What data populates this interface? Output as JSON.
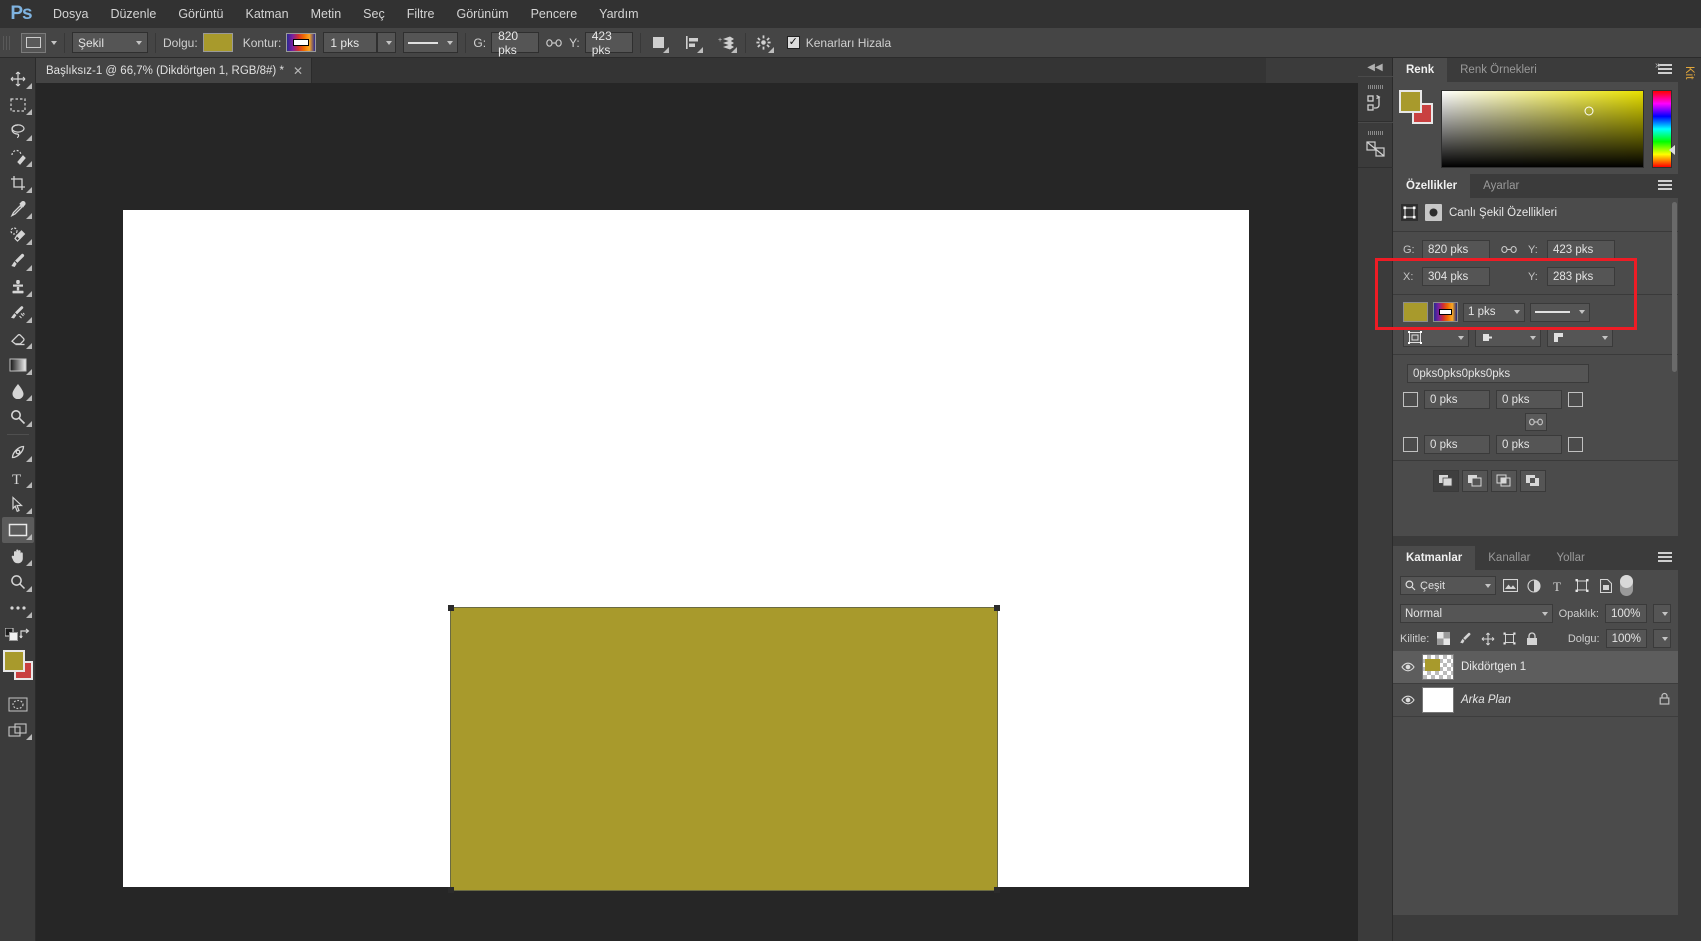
{
  "app": {
    "logo": "Ps"
  },
  "menu": {
    "items": [
      "Dosya",
      "Düzenle",
      "Görüntü",
      "Katman",
      "Metin",
      "Seç",
      "Filtre",
      "Görünüm",
      "Pencere",
      "Yardım"
    ]
  },
  "options_bar": {
    "tool_preset_label": "shape-tool-preset",
    "mode_value": "Şekil",
    "fill_label": "Dolgu:",
    "fill_color": "#a89a2c",
    "stroke_label": "Kontur:",
    "stroke_width": "1 pks",
    "stroke_style_label": "solid-line",
    "w_label": "G:",
    "w_value": "820 pks",
    "link_label": "link-wh",
    "h_label": "Y:",
    "h_value": "423 pks",
    "path_op_label": "path-operations",
    "align_label": "path-alignment",
    "arrange_label": "path-arrangement",
    "gear_label": "geometry-options",
    "align_edges_checked": true,
    "align_edges_label": "Kenarları Hizala"
  },
  "document_tab": {
    "title": "Başlıksız-1 @ 66,7% (Dikdörtgen 1, RGB/8#) *",
    "close": "✕"
  },
  "toolbar": {
    "tools": [
      {
        "name": "move-tool",
        "active": false
      },
      {
        "name": "rectangular-marquee-tool",
        "active": false
      },
      {
        "name": "lasso-tool",
        "active": false
      },
      {
        "name": "quick-selection-tool",
        "active": false
      },
      {
        "name": "crop-tool",
        "active": false
      },
      {
        "name": "eyedropper-tool",
        "active": false
      },
      {
        "name": "spot-healing-brush-tool",
        "active": false
      },
      {
        "name": "brush-tool",
        "active": false
      },
      {
        "name": "clone-stamp-tool",
        "active": false
      },
      {
        "name": "history-brush-tool",
        "active": false
      },
      {
        "name": "eraser-tool",
        "active": false
      },
      {
        "name": "gradient-tool",
        "active": false
      },
      {
        "name": "blur-tool",
        "active": false
      },
      {
        "name": "dodge-tool",
        "active": false
      },
      {
        "name": "pen-tool",
        "active": false
      },
      {
        "name": "type-tool",
        "active": false
      },
      {
        "name": "path-selection-tool",
        "active": false
      },
      {
        "name": "rectangle-tool",
        "active": true
      },
      {
        "name": "hand-tool",
        "active": false
      },
      {
        "name": "zoom-tool",
        "active": false
      },
      {
        "name": "edit-toolbar-tool",
        "active": false
      }
    ],
    "foreground_color": "#a89a2c",
    "background_color": "#c94040"
  },
  "canvas": {
    "background": "#262626",
    "paper_color": "#ffffff",
    "shape_color": "#a89a2c",
    "zoom": "66,7%"
  },
  "right_dock_icons": [
    {
      "name": "history-panel-icon"
    },
    {
      "name": "paths-panel-icon"
    }
  ],
  "color_panel": {
    "tabs": [
      {
        "label": "Renk",
        "active": true
      },
      {
        "label": "Renk Örnekleri",
        "active": false
      }
    ],
    "foreground": "#a89a2c",
    "background": "#c94040",
    "menu_label": "panel-menu"
  },
  "properties_panel": {
    "tabs": [
      {
        "label": "Özellikler",
        "active": true
      },
      {
        "label": "Ayarlar",
        "active": false
      }
    ],
    "header_title": "Canlı Şekil Özellikleri",
    "w_label": "G:",
    "w_value": "820 pks",
    "link_label": "link-width-height",
    "h_label": "Y:",
    "h_value": "423 pks",
    "x_label": "X:",
    "x_value": "304 pks",
    "y_label": "Y:",
    "y_value": "283 pks",
    "fill_color": "#a89a2c",
    "stroke_width": "1 pks",
    "stroke_style_label": "solid-line",
    "stroke_align_label": "stroke-alignment",
    "stroke_cap_label": "stroke-cap",
    "stroke_corner_label": "stroke-corner",
    "corner_radius_summary": "0pks0pks0pks0pks",
    "corner_tl": "0 pks",
    "corner_tr": "0 pks",
    "corner_bl": "0 pks",
    "corner_br": "0 pks",
    "corner_link_label": "link-corner-radii",
    "path_ops": [
      {
        "name": "combine-shapes",
        "active": true
      },
      {
        "name": "subtract-front-shape",
        "active": false
      },
      {
        "name": "intersect-shape-areas",
        "active": false
      },
      {
        "name": "exclude-overlapping-shapes",
        "active": false
      }
    ],
    "highlight_color": "#ee1c25"
  },
  "layers_panel": {
    "tabs": [
      {
        "label": "Katmanlar",
        "active": true
      },
      {
        "label": "Kanallar",
        "active": false
      },
      {
        "label": "Yollar",
        "active": false
      }
    ],
    "filter_label": "Çeşit",
    "filter_icons": [
      "pixel-filter-icon",
      "adjustment-filter-icon",
      "type-filter-icon",
      "shape-filter-icon",
      "smart-object-filter-icon"
    ],
    "blend_mode": "Normal",
    "opacity_label": "Opaklık:",
    "opacity_value": "100%",
    "lock_label": "Kilitle:",
    "lock_icons": [
      "lock-transparent-pixels-icon",
      "lock-image-pixels-icon",
      "lock-position-icon",
      "lock-artboard-icon",
      "lock-all-icon"
    ],
    "fill_label": "Dolgu:",
    "fill_value": "100%",
    "layers": [
      {
        "name": "Dikdörtgen 1",
        "visible": true,
        "selected": true,
        "locked": false,
        "italic": false
      },
      {
        "name": "Arka Plan",
        "visible": true,
        "selected": false,
        "locked": true,
        "italic": true
      }
    ]
  },
  "edge_panel": {
    "label": "Kit",
    "collapse_label": "»"
  }
}
